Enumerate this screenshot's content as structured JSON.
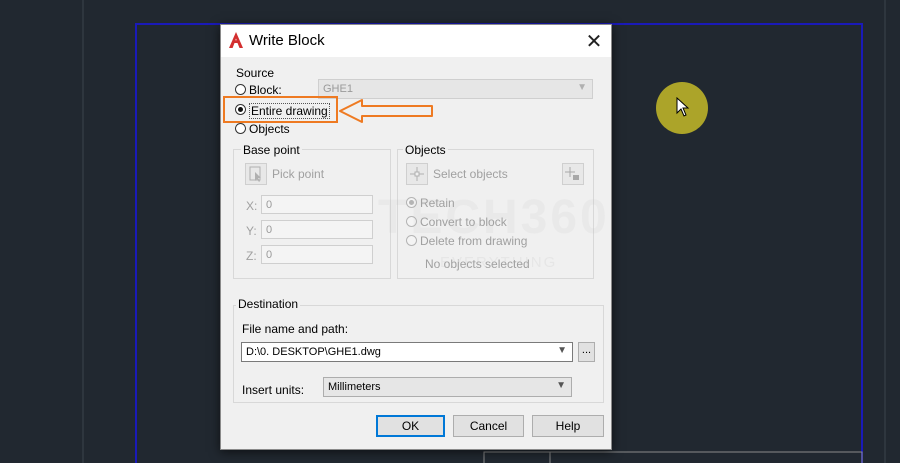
{
  "dialog": {
    "title": "Write Block",
    "source": {
      "label": "Source",
      "block_label": "Block:",
      "block_value": "GHE1",
      "entire_drawing_label": "Entire drawing",
      "objects_label": "Objects",
      "selected": "entire_drawing"
    },
    "base_point": {
      "label": "Base point",
      "pick_point_label": "Pick point",
      "x_label": "X:",
      "x_value": "0",
      "y_label": "Y:",
      "y_value": "0",
      "z_label": "Z:",
      "z_value": "0"
    },
    "objects": {
      "label": "Objects",
      "select_objects_label": "Select objects",
      "retain_label": "Retain",
      "convert_label": "Convert to block",
      "delete_label": "Delete from drawing",
      "status": "No objects selected"
    },
    "destination": {
      "label": "Destination",
      "file_label": "File name and path:",
      "file_value": "D:\\0. DESKTOP\\GHE1.dwg",
      "browse_label": "...",
      "units_label": "Insert units:",
      "units_value": "Millimeters"
    },
    "buttons": {
      "ok": "OK",
      "cancel": "Cancel",
      "help": "Help"
    }
  },
  "watermark": {
    "main": "TECH360",
    "sub": "EVERYTHING"
  },
  "colors": {
    "annotation": "#ee7a22",
    "cad_background": "#212830",
    "drawing_frame": "#1a1ab8",
    "cursor_halo": "#c4ba28"
  },
  "icons": [
    "autocad-logo-icon",
    "close-icon",
    "pick-point-icon",
    "select-objects-icon",
    "quick-select-icon",
    "chevron-down-icon",
    "annotation-arrow-icon",
    "mouse-cursor-icon"
  ]
}
